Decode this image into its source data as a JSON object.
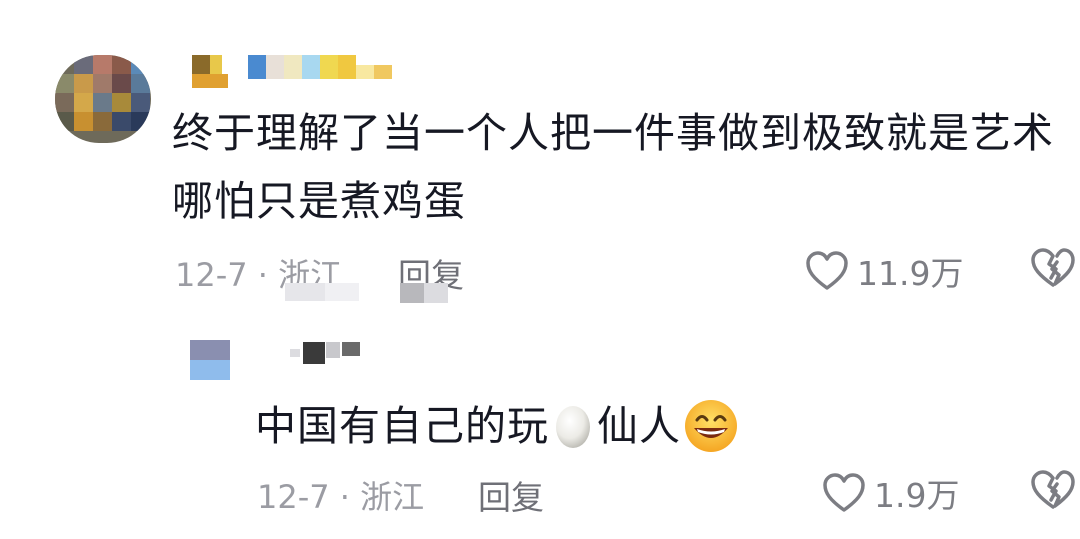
{
  "comment": {
    "text_line1": "终于理解了当一个人把一件事做到极致就是艺术",
    "text_line2": "哪怕只是煮鸡蛋",
    "date_location": "12-7 · 浙江",
    "reply_label": "回复",
    "like_count": "11.9万"
  },
  "reply": {
    "text": "中国有自己的玩",
    "text_after_egg": "仙人",
    "date_location": "12-7 · 浙江",
    "reply_label": "回复",
    "like_count": "1.9万"
  },
  "icons": {
    "like": "heart-outline-icon",
    "dislike": "broken-heart-icon",
    "egg": "egg-emoji",
    "grin": "grinning-face-emoji"
  },
  "colors": {
    "text": "#161823",
    "meta": "#9b9ca3",
    "icon": "#7c7d83"
  }
}
